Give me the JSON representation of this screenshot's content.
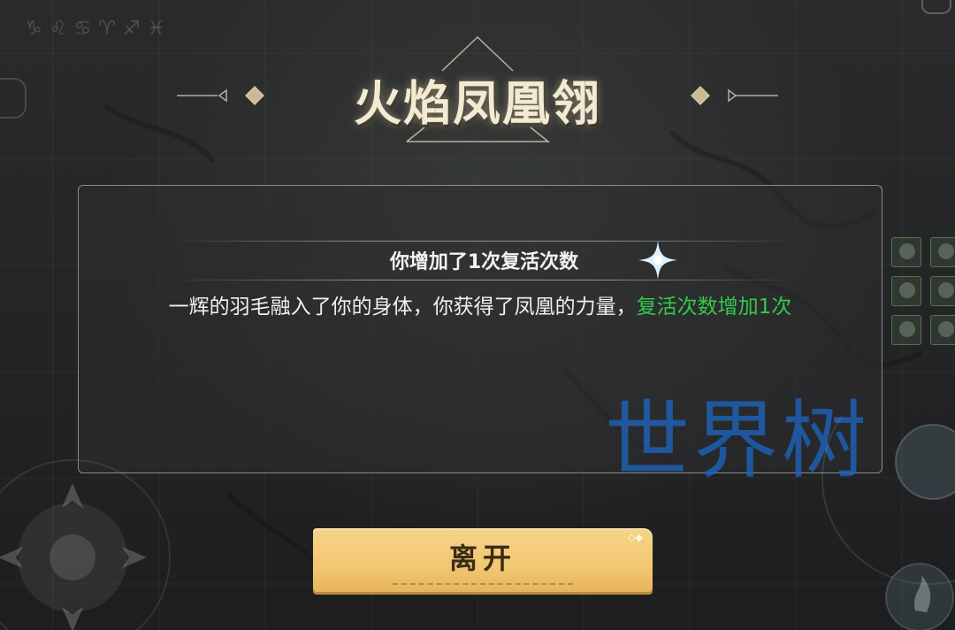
{
  "title": "火焰凤凰翎",
  "dialog": {
    "subtitle": "你增加了1次复活次数",
    "message_prefix": "一辉的羽毛融入了你的身体，你获得了凤凰的力量，",
    "message_highlight": "复活次数增加1次"
  },
  "leave_button": {
    "label": "离开"
  },
  "watermark": "世界树",
  "background": {
    "zodiac_symbols": "♑♌♋♈♐♓"
  },
  "colors": {
    "highlight": "#35c94b",
    "button": "#f2c772",
    "title": "#f3ead3",
    "watermark": "#1e64be"
  },
  "icons": {
    "sparkle": "sparkle-icon",
    "joystick": "joystick-icon",
    "skill": "skill-ring-icon"
  }
}
